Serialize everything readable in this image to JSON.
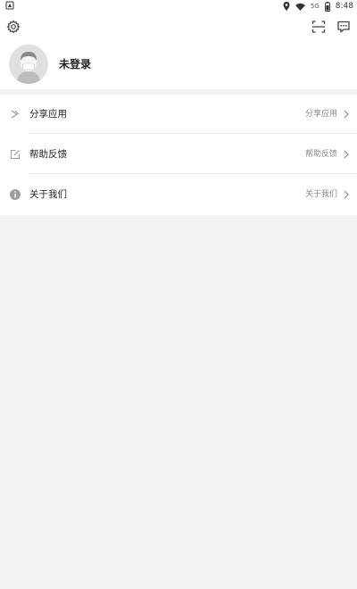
{
  "status_bar": {
    "time": "8:48",
    "network_label": "5G"
  },
  "icons": {
    "settings": "gear-icon",
    "scan": "scan-icon",
    "messages": "chat-icon",
    "share": "share-arrow-icon",
    "help": "edit-icon",
    "about": "info-icon",
    "chevron": "chevron-right-icon"
  },
  "profile": {
    "name": "未登录"
  },
  "menu": {
    "items": [
      {
        "label": "分享应用",
        "value": "分享应用"
      },
      {
        "label": "帮助反馈",
        "value": "帮助反馈"
      },
      {
        "label": "关于我们",
        "value": "关于我们"
      }
    ]
  },
  "colors": {
    "page_bg": "#f2f2f2",
    "card_bg": "#ffffff",
    "text_primary": "#222222",
    "text_secondary": "#888888"
  }
}
